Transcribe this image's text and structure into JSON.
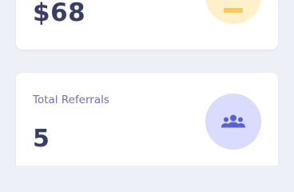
{
  "cards": [
    {
      "value": "$68",
      "icon": "wallet-icon",
      "icon_bg": "#fff0cc",
      "icon_color": "#f7c85b"
    },
    {
      "label": "Total Referrals",
      "value": "5",
      "icon": "users-icon",
      "icon_bg": "#d9dbff",
      "icon_color": "#5b5fd6"
    }
  ]
}
